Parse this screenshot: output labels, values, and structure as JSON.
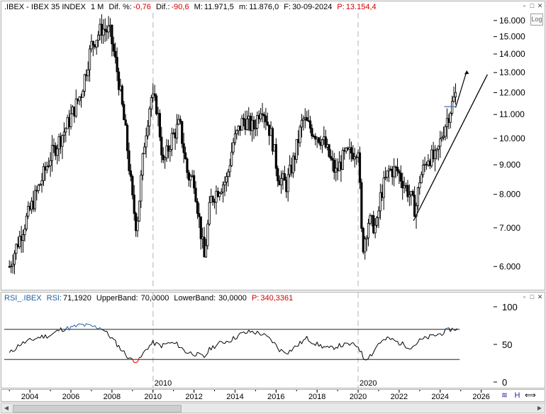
{
  "header": {
    "symbol": ".IBEX - IBEX 35 INDEX",
    "timeframe": "1 M",
    "dif_pct_label": "Dif. %:",
    "dif_pct_value": "-0,76",
    "dif_label": "Dif.:",
    "dif_value": "-90,6",
    "max_label": "M:",
    "max_value": "11.971,5",
    "min_label": "m:",
    "min_value": "11.876,0",
    "date_label": "F:",
    "date_value": "30-09-2024",
    "price_label": "P:",
    "price_value": "13.154,4"
  },
  "log_button": "Log",
  "rsi_header": {
    "name": "RSI_.IBEX",
    "rsi_label": "RSI:",
    "rsi_value": "71,1920",
    "upper_label": "UpperBand:",
    "upper_value": "70,0000",
    "lower_label": "LowerBand:",
    "lower_value": "30,0000",
    "p_label": "P:",
    "p_value": "340,3361"
  },
  "colors": {
    "candles": "#000000",
    "rsi_line": "#000000",
    "rsi_overbought": "#1f5fa8",
    "rsi_oversold": "#d00000",
    "header_red": "#d00000",
    "header_blue": "#1f5fa8",
    "grid_dash": "#cccccc"
  },
  "chart_data": [
    {
      "type": "candlestick",
      "scale": "log",
      "title": ".IBEX - IBEX 35 INDEX",
      "ylim": [
        5500,
        16500
      ],
      "yticks": [
        6000,
        7000,
        8000,
        9000,
        10000,
        11000,
        12000,
        13000,
        14000,
        15000,
        16000
      ],
      "ytick_labels": [
        "6.000",
        "7.000",
        "8.000",
        "9.000",
        "10.000",
        "11.000",
        "12.000",
        "13.000",
        "14.000",
        "15.000",
        "16.000"
      ],
      "xlim": [
        2002.75,
        2026.6
      ],
      "path": [
        [
          2003.0,
          6000
        ],
        [
          2003.6,
          6900
        ],
        [
          2004.3,
          8000
        ],
        [
          2005.0,
          9300
        ],
        [
          2005.8,
          10500
        ],
        [
          2006.5,
          12000
        ],
        [
          2007.0,
          14500
        ],
        [
          2007.5,
          15500
        ],
        [
          2007.9,
          15300
        ],
        [
          2008.3,
          12800
        ],
        [
          2008.7,
          10000
        ],
        [
          2009.0,
          7800
        ],
        [
          2009.2,
          7000
        ],
        [
          2009.6,
          10000
        ],
        [
          2009.9,
          11800
        ],
        [
          2010.2,
          11300
        ],
        [
          2010.5,
          9000
        ],
        [
          2010.9,
          10000
        ],
        [
          2011.3,
          10600
        ],
        [
          2011.7,
          8600
        ],
        [
          2012.0,
          8500
        ],
        [
          2012.3,
          7000
        ],
        [
          2012.5,
          6200
        ],
        [
          2012.8,
          7800
        ],
        [
          2013.2,
          8200
        ],
        [
          2013.6,
          8500
        ],
        [
          2013.9,
          9800
        ],
        [
          2014.4,
          10800
        ],
        [
          2014.9,
          10400
        ],
        [
          2015.3,
          11500
        ],
        [
          2015.8,
          10000
        ],
        [
          2016.1,
          8600
        ],
        [
          2016.5,
          8300
        ],
        [
          2016.9,
          9300
        ],
        [
          2017.3,
          10800
        ],
        [
          2017.8,
          10300
        ],
        [
          2018.3,
          9900
        ],
        [
          2018.9,
          8700
        ],
        [
          2019.3,
          9300
        ],
        [
          2019.8,
          9500
        ],
        [
          2020.0,
          9700
        ],
        [
          2020.2,
          6400
        ],
        [
          2020.5,
          7200
        ],
        [
          2020.9,
          7000
        ],
        [
          2021.1,
          8000
        ],
        [
          2021.5,
          8800
        ],
        [
          2021.9,
          8800
        ],
        [
          2022.2,
          8400
        ],
        [
          2022.5,
          8000
        ],
        [
          2022.8,
          7500
        ],
        [
          2023.0,
          8500
        ],
        [
          2023.4,
          9300
        ],
        [
          2023.8,
          9200
        ],
        [
          2024.1,
          10200
        ],
        [
          2024.4,
          11000
        ],
        [
          2024.75,
          11900
        ]
      ],
      "annotations": [
        {
          "type": "trendline",
          "from": [
            2022.7,
            7200
          ],
          "to": [
            2026.3,
            12900
          ]
        },
        {
          "type": "arrow",
          "from": [
            2024.75,
            11300
          ],
          "to": [
            2025.3,
            13100
          ]
        },
        {
          "type": "hline",
          "from": [
            2024.2,
            11350
          ],
          "to": [
            2024.8,
            11350
          ]
        }
      ]
    },
    {
      "type": "line",
      "title": "RSI_.IBEX",
      "ylim": [
        0,
        100
      ],
      "yticks": [
        0,
        50,
        100
      ],
      "ytick_labels": [
        "0",
        "50",
        "100"
      ],
      "bands": [
        70,
        30
      ],
      "xlim": [
        2002.75,
        2026.6
      ],
      "series": [
        {
          "name": "RSI",
          "points": [
            [
              2003.0,
              38
            ],
            [
              2003.5,
              50
            ],
            [
              2004.0,
              55
            ],
            [
              2004.5,
              60
            ],
            [
              2005.0,
              62
            ],
            [
              2005.5,
              70
            ],
            [
              2006.0,
              72
            ],
            [
              2006.5,
              76
            ],
            [
              2007.0,
              74
            ],
            [
              2007.5,
              72
            ],
            [
              2008.0,
              58
            ],
            [
              2008.5,
              42
            ],
            [
              2008.9,
              30
            ],
            [
              2009.3,
              28
            ],
            [
              2009.7,
              45
            ],
            [
              2010.0,
              52
            ],
            [
              2010.4,
              48
            ],
            [
              2010.8,
              52
            ],
            [
              2011.2,
              50
            ],
            [
              2011.6,
              40
            ],
            [
              2012.0,
              38
            ],
            [
              2012.5,
              33
            ],
            [
              2012.8,
              45
            ],
            [
              2013.3,
              52
            ],
            [
              2013.8,
              56
            ],
            [
              2014.3,
              64
            ],
            [
              2014.8,
              67
            ],
            [
              2015.3,
              64
            ],
            [
              2015.8,
              55
            ],
            [
              2016.2,
              42
            ],
            [
              2016.6,
              40
            ],
            [
              2017.0,
              48
            ],
            [
              2017.5,
              58
            ],
            [
              2018.0,
              50
            ],
            [
              2018.6,
              44
            ],
            [
              2019.0,
              48
            ],
            [
              2019.6,
              50
            ],
            [
              2020.0,
              48
            ],
            [
              2020.3,
              30
            ],
            [
              2020.7,
              38
            ],
            [
              2021.0,
              52
            ],
            [
              2021.5,
              58
            ],
            [
              2022.0,
              52
            ],
            [
              2022.6,
              46
            ],
            [
              2023.0,
              55
            ],
            [
              2023.5,
              60
            ],
            [
              2024.0,
              64
            ],
            [
              2024.5,
              70
            ],
            [
              2024.9,
              71.19
            ]
          ]
        }
      ]
    }
  ],
  "xaxis": {
    "labels": [
      "2004",
      "2006",
      "2008",
      "2010",
      "2012",
      "2014",
      "2016",
      "2018",
      "2020",
      "2022",
      "2024",
      "2026"
    ],
    "label_years": [
      2004,
      2006,
      2008,
      2010,
      2012,
      2014,
      2016,
      2018,
      2020,
      2022,
      2024,
      2026
    ],
    "separator_labels": [
      "2010",
      "2020"
    ],
    "separator_years": [
      2010,
      2020
    ]
  },
  "toolbar": {
    "rsi_icon_label": "≋",
    "cursor_icon_label": "H",
    "sync_icon_label": "⟺"
  }
}
